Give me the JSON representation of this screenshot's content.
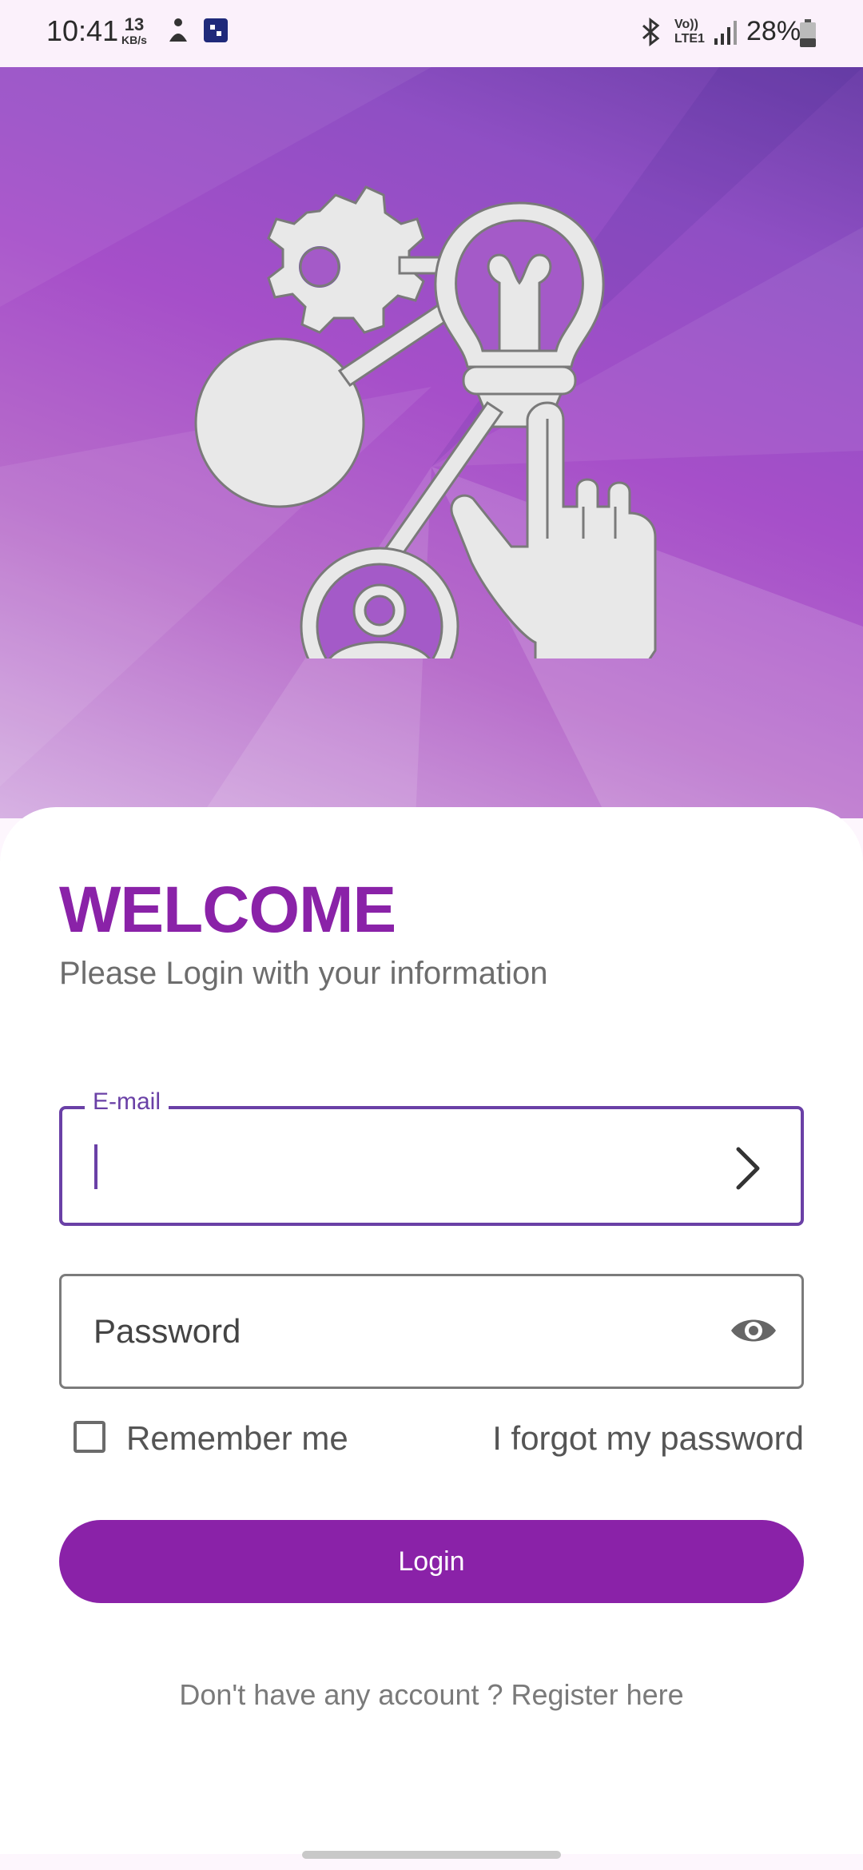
{
  "status_bar": {
    "time": "10:41",
    "net_speed": "13",
    "net_unit": "KB/s",
    "volte": "Vo))",
    "lte": "LTE1",
    "battery": "28%"
  },
  "hero": {
    "icon": "idea-network-hand-icon"
  },
  "login": {
    "title": "WELCOME",
    "subtitle": "Please Login with your information",
    "email_label": "E-mail",
    "email_value": "",
    "password_placeholder": "Password",
    "remember_label": "Remember me",
    "forgot_label": "I forgot my password",
    "login_button": "Login",
    "register_text": "Don't have any account ? Register here"
  },
  "colors": {
    "accent": "#8a22a8",
    "field_focus": "#6a40a6"
  }
}
